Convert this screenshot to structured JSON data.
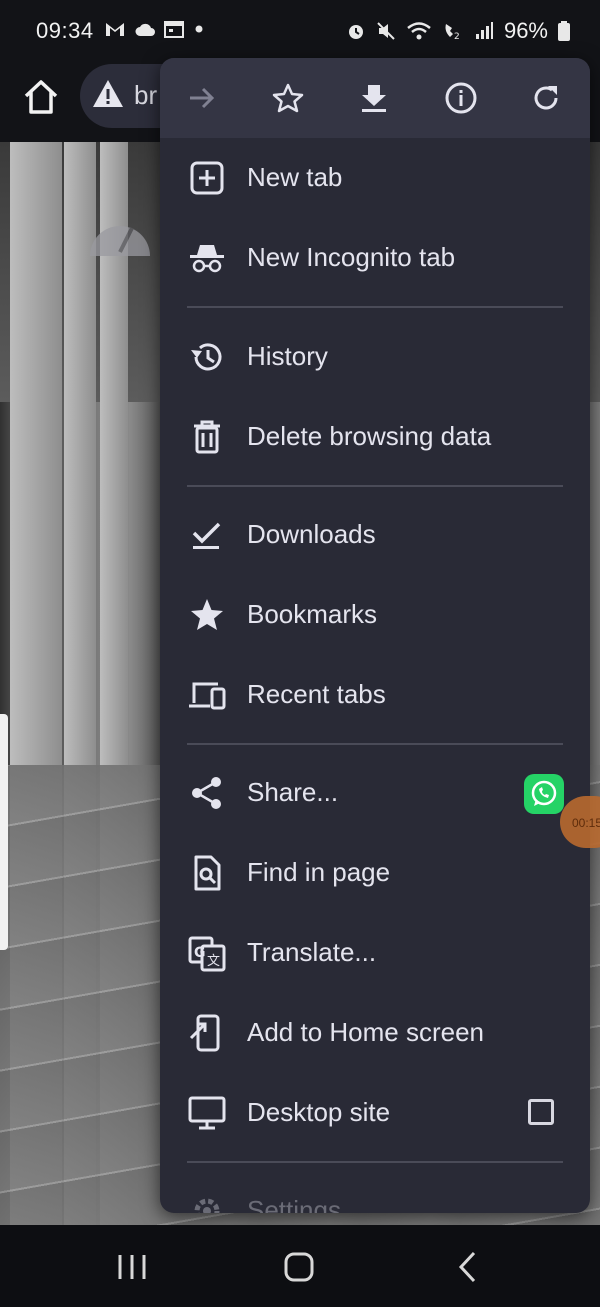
{
  "status_bar": {
    "time": "09:34",
    "battery": "96%",
    "left_icons": [
      "gmail-icon",
      "cloud-icon",
      "calendar-icon",
      "dot-icon"
    ],
    "right_icons": [
      "alarm-icon",
      "mute-icon",
      "wifi-icon",
      "volte-icon",
      "signal-icon",
      "battery-icon"
    ]
  },
  "toolbar": {
    "url_text": "br",
    "home_icon": "home-icon",
    "warning_icon": "warning-icon"
  },
  "menu": {
    "top_actions": [
      {
        "icon": "forward-arrow-icon"
      },
      {
        "icon": "star-outline-icon"
      },
      {
        "icon": "download-icon"
      },
      {
        "icon": "info-icon"
      },
      {
        "icon": "reload-icon"
      }
    ],
    "items": [
      {
        "label": "New tab",
        "icon": "new-tab-icon"
      },
      {
        "label": "New Incognito tab",
        "icon": "incognito-icon"
      },
      {
        "label": "History",
        "icon": "history-icon"
      },
      {
        "label": "Delete browsing data",
        "icon": "trash-icon"
      },
      {
        "label": "Downloads",
        "icon": "downloads-check-icon"
      },
      {
        "label": "Bookmarks",
        "icon": "star-icon"
      },
      {
        "label": "Recent tabs",
        "icon": "devices-icon"
      },
      {
        "label": "Share...",
        "icon": "share-icon"
      },
      {
        "label": "Find in page",
        "icon": "find-in-page-icon"
      },
      {
        "label": "Translate...",
        "icon": "translate-icon"
      },
      {
        "label": "Add to Home screen",
        "icon": "add-to-home-icon"
      },
      {
        "label": "Desktop site",
        "icon": "desktop-icon"
      },
      {
        "label": "Settings",
        "icon": "settings-gear-icon"
      }
    ],
    "desktop_site_checked": false
  },
  "overlay": {
    "recording_time": "00:15",
    "whatsapp_icon": "whatsapp-icon"
  },
  "colors": {
    "menu_bg": "#292a36",
    "menu_top_bg": "#343544",
    "text": "#e4e4ee",
    "whatsapp": "#25d366"
  }
}
